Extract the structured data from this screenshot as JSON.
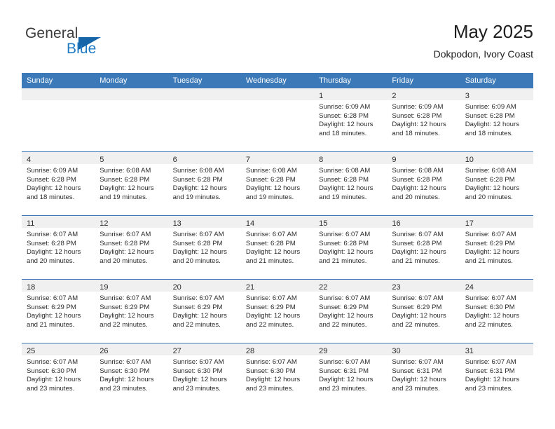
{
  "brand": {
    "name_top": "General",
    "name_bottom": "Blue",
    "triangle_color": "#1565a8",
    "blue_color": "#1f7ac4"
  },
  "header": {
    "title": "May 2025",
    "subtitle": "Dokpodon, Ivory Coast"
  },
  "theme": {
    "header_bar_color": "#3b79b8",
    "day_strip_color": "#f0f0f0",
    "text_color": "#2b2b2b"
  },
  "calendar": {
    "weekday_headers": [
      "Sunday",
      "Monday",
      "Tuesday",
      "Wednesday",
      "Thursday",
      "Friday",
      "Saturday"
    ],
    "leading_blanks": 4,
    "weeks": [
      [
        {
          "day": "",
          "lines": []
        },
        {
          "day": "",
          "lines": []
        },
        {
          "day": "",
          "lines": []
        },
        {
          "day": "",
          "lines": []
        },
        {
          "day": "1",
          "lines": [
            "Sunrise: 6:09 AM",
            "Sunset: 6:28 PM",
            "Daylight: 12 hours",
            "and 18 minutes."
          ]
        },
        {
          "day": "2",
          "lines": [
            "Sunrise: 6:09 AM",
            "Sunset: 6:28 PM",
            "Daylight: 12 hours",
            "and 18 minutes."
          ]
        },
        {
          "day": "3",
          "lines": [
            "Sunrise: 6:09 AM",
            "Sunset: 6:28 PM",
            "Daylight: 12 hours",
            "and 18 minutes."
          ]
        }
      ],
      [
        {
          "day": "4",
          "lines": [
            "Sunrise: 6:09 AM",
            "Sunset: 6:28 PM",
            "Daylight: 12 hours",
            "and 18 minutes."
          ]
        },
        {
          "day": "5",
          "lines": [
            "Sunrise: 6:08 AM",
            "Sunset: 6:28 PM",
            "Daylight: 12 hours",
            "and 19 minutes."
          ]
        },
        {
          "day": "6",
          "lines": [
            "Sunrise: 6:08 AM",
            "Sunset: 6:28 PM",
            "Daylight: 12 hours",
            "and 19 minutes."
          ]
        },
        {
          "day": "7",
          "lines": [
            "Sunrise: 6:08 AM",
            "Sunset: 6:28 PM",
            "Daylight: 12 hours",
            "and 19 minutes."
          ]
        },
        {
          "day": "8",
          "lines": [
            "Sunrise: 6:08 AM",
            "Sunset: 6:28 PM",
            "Daylight: 12 hours",
            "and 19 minutes."
          ]
        },
        {
          "day": "9",
          "lines": [
            "Sunrise: 6:08 AM",
            "Sunset: 6:28 PM",
            "Daylight: 12 hours",
            "and 20 minutes."
          ]
        },
        {
          "day": "10",
          "lines": [
            "Sunrise: 6:08 AM",
            "Sunset: 6:28 PM",
            "Daylight: 12 hours",
            "and 20 minutes."
          ]
        }
      ],
      [
        {
          "day": "11",
          "lines": [
            "Sunrise: 6:07 AM",
            "Sunset: 6:28 PM",
            "Daylight: 12 hours",
            "and 20 minutes."
          ]
        },
        {
          "day": "12",
          "lines": [
            "Sunrise: 6:07 AM",
            "Sunset: 6:28 PM",
            "Daylight: 12 hours",
            "and 20 minutes."
          ]
        },
        {
          "day": "13",
          "lines": [
            "Sunrise: 6:07 AM",
            "Sunset: 6:28 PM",
            "Daylight: 12 hours",
            "and 20 minutes."
          ]
        },
        {
          "day": "14",
          "lines": [
            "Sunrise: 6:07 AM",
            "Sunset: 6:28 PM",
            "Daylight: 12 hours",
            "and 21 minutes."
          ]
        },
        {
          "day": "15",
          "lines": [
            "Sunrise: 6:07 AM",
            "Sunset: 6:28 PM",
            "Daylight: 12 hours",
            "and 21 minutes."
          ]
        },
        {
          "day": "16",
          "lines": [
            "Sunrise: 6:07 AM",
            "Sunset: 6:28 PM",
            "Daylight: 12 hours",
            "and 21 minutes."
          ]
        },
        {
          "day": "17",
          "lines": [
            "Sunrise: 6:07 AM",
            "Sunset: 6:29 PM",
            "Daylight: 12 hours",
            "and 21 minutes."
          ]
        }
      ],
      [
        {
          "day": "18",
          "lines": [
            "Sunrise: 6:07 AM",
            "Sunset: 6:29 PM",
            "Daylight: 12 hours",
            "and 21 minutes."
          ]
        },
        {
          "day": "19",
          "lines": [
            "Sunrise: 6:07 AM",
            "Sunset: 6:29 PM",
            "Daylight: 12 hours",
            "and 22 minutes."
          ]
        },
        {
          "day": "20",
          "lines": [
            "Sunrise: 6:07 AM",
            "Sunset: 6:29 PM",
            "Daylight: 12 hours",
            "and 22 minutes."
          ]
        },
        {
          "day": "21",
          "lines": [
            "Sunrise: 6:07 AM",
            "Sunset: 6:29 PM",
            "Daylight: 12 hours",
            "and 22 minutes."
          ]
        },
        {
          "day": "22",
          "lines": [
            "Sunrise: 6:07 AM",
            "Sunset: 6:29 PM",
            "Daylight: 12 hours",
            "and 22 minutes."
          ]
        },
        {
          "day": "23",
          "lines": [
            "Sunrise: 6:07 AM",
            "Sunset: 6:29 PM",
            "Daylight: 12 hours",
            "and 22 minutes."
          ]
        },
        {
          "day": "24",
          "lines": [
            "Sunrise: 6:07 AM",
            "Sunset: 6:30 PM",
            "Daylight: 12 hours",
            "and 22 minutes."
          ]
        }
      ],
      [
        {
          "day": "25",
          "lines": [
            "Sunrise: 6:07 AM",
            "Sunset: 6:30 PM",
            "Daylight: 12 hours",
            "and 23 minutes."
          ]
        },
        {
          "day": "26",
          "lines": [
            "Sunrise: 6:07 AM",
            "Sunset: 6:30 PM",
            "Daylight: 12 hours",
            "and 23 minutes."
          ]
        },
        {
          "day": "27",
          "lines": [
            "Sunrise: 6:07 AM",
            "Sunset: 6:30 PM",
            "Daylight: 12 hours",
            "and 23 minutes."
          ]
        },
        {
          "day": "28",
          "lines": [
            "Sunrise: 6:07 AM",
            "Sunset: 6:30 PM",
            "Daylight: 12 hours",
            "and 23 minutes."
          ]
        },
        {
          "day": "29",
          "lines": [
            "Sunrise: 6:07 AM",
            "Sunset: 6:31 PM",
            "Daylight: 12 hours",
            "and 23 minutes."
          ]
        },
        {
          "day": "30",
          "lines": [
            "Sunrise: 6:07 AM",
            "Sunset: 6:31 PM",
            "Daylight: 12 hours",
            "and 23 minutes."
          ]
        },
        {
          "day": "31",
          "lines": [
            "Sunrise: 6:07 AM",
            "Sunset: 6:31 PM",
            "Daylight: 12 hours",
            "and 23 minutes."
          ]
        }
      ]
    ]
  }
}
